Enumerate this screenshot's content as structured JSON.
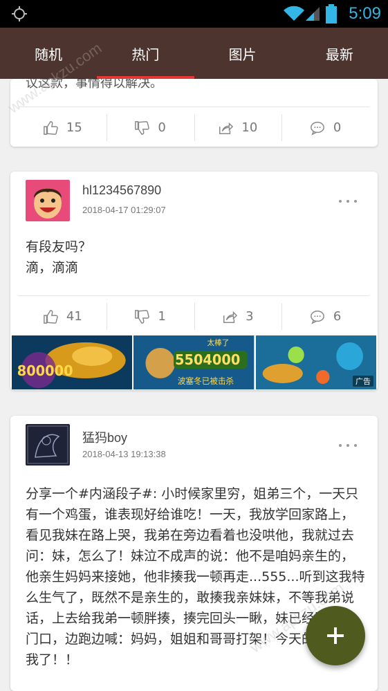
{
  "status_bar": {
    "time": "5:09",
    "icons": [
      "gps-icon",
      "wifi-icon",
      "signal-icon",
      "battery-icon"
    ]
  },
  "tabs": [
    {
      "label": "随机",
      "active": false
    },
    {
      "label": "热门",
      "active": true
    },
    {
      "label": "图片",
      "active": false
    },
    {
      "label": "最新",
      "active": false
    }
  ],
  "posts": [
    {
      "partial_text": "议这款，事情得以解决。",
      "likes": "15",
      "dislikes": "0",
      "shares": "10",
      "comments": "0"
    },
    {
      "username": "hl1234567890",
      "timestamp": "2018-04-17 01:29:07",
      "text": "有段友吗？\n滴，滴滴",
      "likes": "41",
      "dislikes": "1",
      "shares": "3",
      "comments": "6",
      "ad": {
        "label": "广告",
        "image_texts": [
          "800000",
          "太棒了",
          "5504000",
          "波塞冬已被击杀"
        ]
      }
    },
    {
      "username": "猛犸boy",
      "timestamp": "2018-04-13 19:13:38",
      "text": "分享一个#内涵段子#: 小时候家里穷，姐弟三个，一天只有一个鸡蛋，谁表现好给谁吃！一天，我放学回家路上，看见我妹在路上哭，我弟在旁边看着也没哄他，我就过去问：妹，怎么了！妹泣不成声的说：他不是咱妈亲生的，他亲生妈妈来接她，他非揍我一顿再走...555...听到这我特么生气了，既然不是亲生的，敢揍我亲妹妹，不等我弟说话，上去给我弟一顿胖揍，揍完回头一瞅，妹已经跑到家门口，边跑边喊：妈妈，姐姐和哥哥打架！今天的鸡蛋归我了！！"
    }
  ],
  "watermark": "www.apkzu.com",
  "colors": {
    "tab_bar": "#4e342e",
    "active_underline": "#e53935",
    "fab": "#4f5a1f",
    "clock": "#33b5e5"
  }
}
